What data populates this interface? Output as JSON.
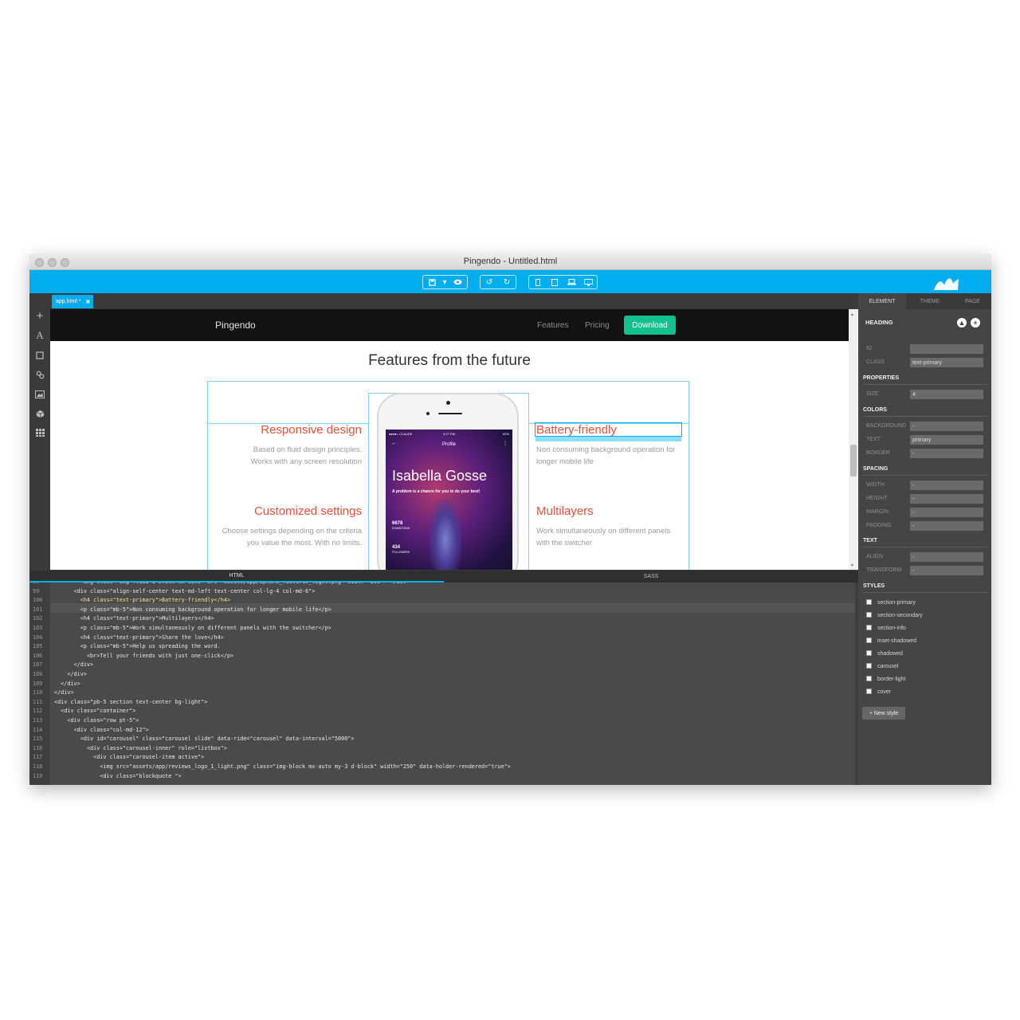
{
  "window": {
    "title": "Pingendo - Untitled.html"
  },
  "file_tab": {
    "label": "app.html *",
    "close": "✖"
  },
  "site": {
    "brand": "Pingendo",
    "nav": [
      "Features",
      "Pricing"
    ],
    "download": "Download",
    "heading": "Features from the future",
    "features": [
      {
        "title": "Responsive design",
        "text": [
          "Based on fluid design principles.",
          "Works with any screen resolution"
        ]
      },
      {
        "title": "Customized settings",
        "text": [
          "Choose settings depending on the criteria",
          "you value the most. With no limits."
        ]
      },
      {
        "title": "Battery-friendly",
        "text": [
          "Non consuming background operation for",
          "longer mobile life"
        ]
      },
      {
        "title": "Multilayers",
        "text": [
          "Work simultaneously on different panels",
          "with the switcher"
        ]
      }
    ],
    "phone": {
      "status_carrier": "●●●●○ CLAUDE",
      "status_time": "3:17 PM",
      "status_battery": "62%",
      "screen_title": "Profile",
      "name": "Isabella Gosse",
      "quote": "A problem is a chance for you to do your best!",
      "stat1_value": "6678",
      "stat1_label": "EXHIBITIONS",
      "stat2_value": "434",
      "stat2_label": "FOLLOWERS"
    }
  },
  "code_tabs": [
    "HTML",
    "SASS"
  ],
  "code_lines": [
    {
      "n": "98",
      "text": "        <img class=\"img-fluid d-block mx-auto\" src=\"assets/app/iphone_features_light.png\" width=\"300\"> </div>"
    },
    {
      "n": "99",
      "text": "      <div class=\"align-self-center text-md-left text-center col-lg-4 col-md-6\">"
    },
    {
      "n": "100",
      "text": "        <h4 class=\"text-primary\">Battery-friendly</h4>"
    },
    {
      "n": "101",
      "text": "        <p class=\"mb-5\">Non consuming background operation for longer mobile life</p>"
    },
    {
      "n": "102",
      "text": "        <h4 class=\"text-primary\">Multilayers</h4>"
    },
    {
      "n": "103",
      "text": "        <p class=\"mb-5\">Work simultaneously on different panels with the switcher</p>"
    },
    {
      "n": "104",
      "text": "        <h4 class=\"text-primary\">Share the love</h4>"
    },
    {
      "n": "105",
      "text": "        <p class=\"mb-5\">Help us spreading the word."
    },
    {
      "n": "106",
      "text": "          <br>Tell your friends with just one-click</p>"
    },
    {
      "n": "107",
      "text": "      </div>"
    },
    {
      "n": "108",
      "text": "    </div>"
    },
    {
      "n": "109",
      "text": "  </div>"
    },
    {
      "n": "110",
      "text": "</div>"
    },
    {
      "n": "111",
      "text": "<div class=\"pb-5 section text-center bg-light\">"
    },
    {
      "n": "112",
      "text": "  <div class=\"container\">"
    },
    {
      "n": "113",
      "text": "    <div class=\"row pt-5\">"
    },
    {
      "n": "114",
      "text": "      <div class=\"col-md-12\">"
    },
    {
      "n": "115",
      "text": "        <div id=\"carousel\" class=\"carousel slide\" data-ride=\"carousel\" data-interval=\"5000\">"
    },
    {
      "n": "116",
      "text": "          <div class=\"carousel-inner\" role=\"listbox\">"
    },
    {
      "n": "117",
      "text": "            <div class=\"carousel-item active\">"
    },
    {
      "n": "118",
      "text": "              <img src=\"assets/app/reviews_logo_1_light.png\" class=\"img-block mx-auto my-3 d-block\" width=\"250\" data-holder-rendered=\"true\">"
    },
    {
      "n": "119",
      "text": "              <div class=\"blockquote \">"
    }
  ],
  "panel": {
    "tabs": [
      "ELEMENT",
      "THEME",
      "PAGE"
    ],
    "element_name": "HEADING",
    "id_label": "ID",
    "id_value": "",
    "class_label": "CLASS",
    "class_value": "text-primary",
    "properties_head": "PROPERTIES",
    "size_label": "SIZE",
    "size_value": "4",
    "colors_head": "COLORS",
    "background_label": "BACKGROUND",
    "background_value": "-",
    "text_label": "TEXT",
    "text_value": "primary",
    "border_label": "BORDER",
    "border_value": "-",
    "spacing_head": "SPACING",
    "width_label": "WIDTH",
    "width_value": "-",
    "height_label": "HEIGHT",
    "height_value": "-",
    "margin_label": "MARGIN",
    "margin_value": "-",
    "padding_label": "PADDING",
    "padding_value": "-",
    "text_head": "TEXT",
    "align_label": "ALIGN",
    "align_value": "-",
    "transform_label": "TRANSFORM",
    "transform_value": "-",
    "styles_head": "STYLES",
    "styles": [
      "section-primary",
      "section-secondary",
      "section-info",
      "inset-shadowed",
      "shadowed",
      "carousel",
      "border-light",
      "cover"
    ],
    "new_style": "+ New style"
  },
  "colors": {
    "toolbar": "#00aeef",
    "accent_red": "#f44c36",
    "download": "#12c28d"
  }
}
